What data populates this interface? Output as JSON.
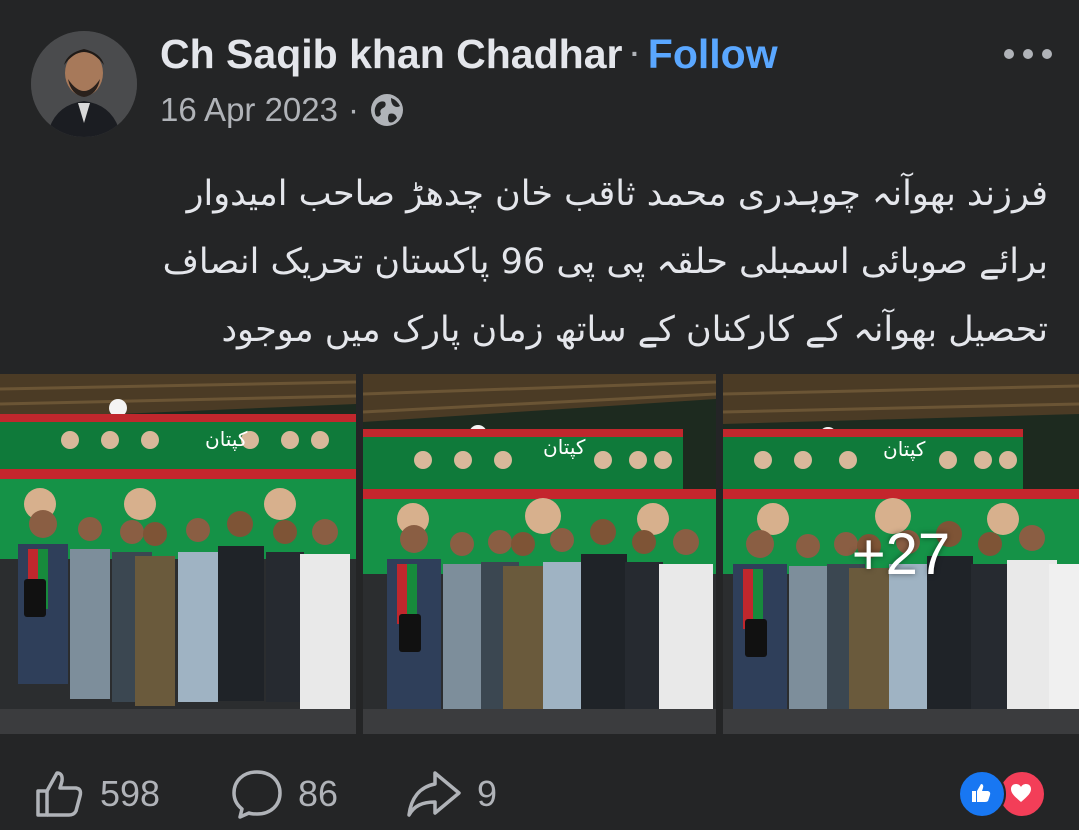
{
  "post": {
    "author": "Ch Saqib khan Chadhar",
    "follow_label": "Follow",
    "date": "16 Apr 2023",
    "privacy_icon": "globe-icon",
    "caption_lines": [
      "فرزند بھوآنہ چوہدری محمد ثاقب خان چدھڑ صاحب امیدوار",
      "برائے صوبائی اسمبلی حلقہ پی پی 96 پاکستان تحریک انصاف",
      "تحصیل بھوآنہ کے کارکنان کے ساتھ زمان پارک میں موجود"
    ],
    "photos": [
      {
        "name": "photo-1",
        "overlay": ""
      },
      {
        "name": "photo-2",
        "overlay": ""
      },
      {
        "name": "photo-3",
        "overlay": "+27"
      }
    ],
    "banner_text": "کپتان"
  },
  "actions": {
    "like_count": "598",
    "comment_count": "86",
    "share_count": "9"
  },
  "colors": {
    "background": "#242526",
    "text": "#e4e6eb",
    "muted": "#b0b3b8",
    "follow": "#5aa7ff",
    "like": "#1877f2",
    "love": "#f33e58"
  }
}
